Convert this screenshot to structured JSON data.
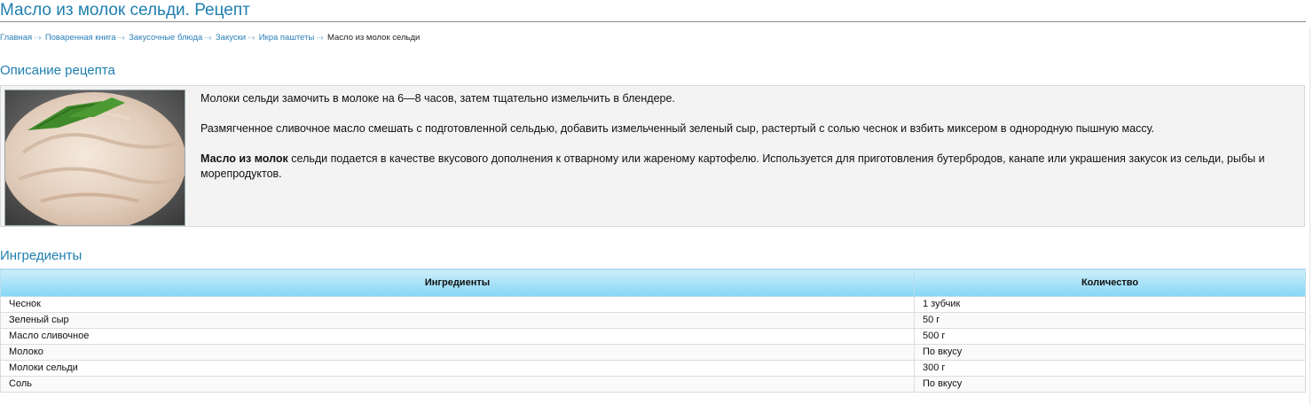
{
  "page": {
    "title": "Масло из молок сельди. Рецепт"
  },
  "breadcrumb": {
    "separator": "··›",
    "items": [
      {
        "label": "Главная"
      },
      {
        "label": "Поваренная книга"
      },
      {
        "label": "Закусочные блюда"
      },
      {
        "label": "Закуски"
      },
      {
        "label": "Икра паштеты"
      }
    ],
    "current": "Масло из молок сельди"
  },
  "description": {
    "heading": "Описание рецепта",
    "paragraph1": "Молоки сельди замочить в молоке на 6—8 часов, затем тщательно измельчить в блендере.",
    "paragraph2": "Размягченное сливочное масло смешать с подготовленной сельдью, добавить измельченный зеленый сыр, растертый с солью чеснок и взбить миксером в однородную пышную массу.",
    "paragraph3_bold": "Масло из молок",
    "paragraph3_rest": " сельди подается в качестве вкусового дополнения к отварному или жареному картофелю. Используется для приготовления бутербродов, канапе или украшения закусок из сельди, рыбы и морепродуктов."
  },
  "ingredients": {
    "heading": "Ингредиенты",
    "columns": [
      "Ингредиенты",
      "Количество"
    ],
    "rows": [
      {
        "name": "Чеснок",
        "amount": "1 зубчик"
      },
      {
        "name": "Зеленый сыр",
        "amount": "50 г"
      },
      {
        "name": "Масло сливочное",
        "amount": "500 г"
      },
      {
        "name": "Молоко",
        "amount": "По вкусу"
      },
      {
        "name": "Молоки сельди",
        "amount": "300 г"
      },
      {
        "name": "Соль",
        "amount": "По вкусу"
      }
    ]
  },
  "colors": {
    "heading": "#1f7fb0",
    "link": "#2b7fb8",
    "table_header_top": "#cdeefb",
    "table_header_bottom": "#86d6f5",
    "desc_background": "#f3f3f3"
  }
}
